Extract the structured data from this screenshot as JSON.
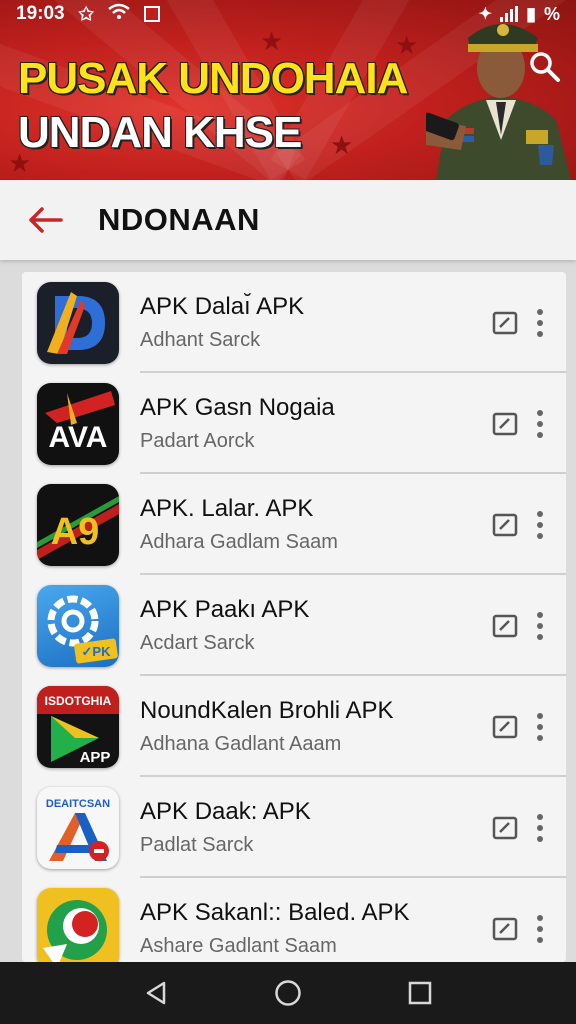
{
  "status_bar": {
    "time": "19:03",
    "battery": "%"
  },
  "banner": {
    "line1": "PUSAK UNDOHAIA",
    "line2": "UNDAN KHSE"
  },
  "app_bar": {
    "title": "NDONAAN"
  },
  "apps": [
    {
      "name": "APK Dalaı̆ APK",
      "subtitle": "Adhant Sarck",
      "icon_text": "D",
      "icon": "app-d-icon"
    },
    {
      "name": "APK Gasn Nogaia",
      "subtitle": "Padart Aorck",
      "icon_text": "AVA",
      "icon": "app-ava-icon"
    },
    {
      "name": "APK. Lalar. APK",
      "subtitle": "Adhara Gadlam Saam",
      "icon_text": "A9",
      "icon": "app-a9-icon"
    },
    {
      "name": "APK Paakı APK",
      "subtitle": "Acdart Sarck",
      "icon_text": "✓PK",
      "icon": "app-gear-icon"
    },
    {
      "name": "NoundKalen Brohli APK",
      "subtitle": "Adhana Gadlant Aaam",
      "icon_text": "APP",
      "icon_top": "ISDOTGHIA",
      "icon": "app-play-icon"
    },
    {
      "name": "APK Daak: APK",
      "subtitle": "Padlat Sarck",
      "icon_top": "DEAITCSAN",
      "icon": "app-a-icon"
    },
    {
      "name": "APK Sakanl:: Baled. APK",
      "subtitle": "Ashare Gadlant Saam",
      "icon": "app-circle-icon"
    }
  ],
  "colors": {
    "banner_red": "#c0201d",
    "banner_yellow": "#ffe21a",
    "accent_back": "#c62828"
  }
}
